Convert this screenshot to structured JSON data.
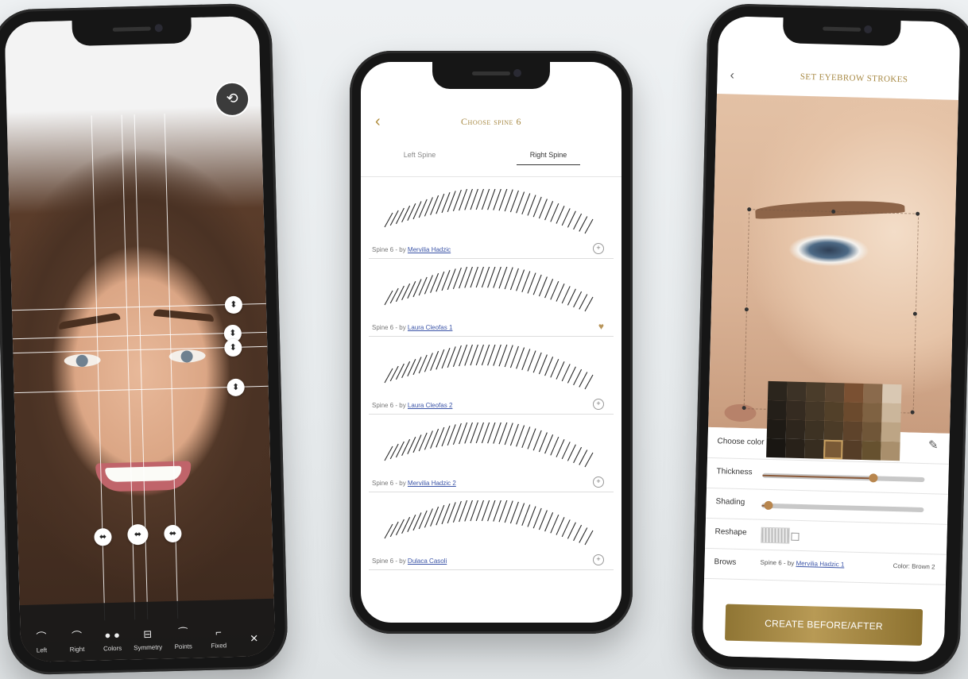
{
  "left_screen": {
    "toolbar": [
      {
        "label": "Left",
        "icon": "brow-left-icon"
      },
      {
        "label": "Right",
        "icon": "brow-right-icon"
      },
      {
        "label": "Colors",
        "icon": "color-dots-icon"
      },
      {
        "label": "Symmetry",
        "icon": "symmetry-icon"
      },
      {
        "label": "Points",
        "icon": "points-icon"
      },
      {
        "label": "Fixed",
        "icon": "fixed-icon"
      },
      {
        "label": "",
        "icon": "close-icon"
      }
    ]
  },
  "center_screen": {
    "title": "Choose spine 6",
    "tabs": [
      {
        "label": "Left Spine",
        "active": false
      },
      {
        "label": "Right Spine",
        "active": true
      }
    ],
    "brows": [
      {
        "prefix": "Spine 6 - by ",
        "author": "Mervilia Hadzic",
        "favorite": false
      },
      {
        "prefix": "Spine 6 - by ",
        "author": "Laura Cleofas 1",
        "favorite": true
      },
      {
        "prefix": "Spine 6 - by ",
        "author": "Laura Cleofas 2",
        "favorite": false
      },
      {
        "prefix": "Spine 6 - by ",
        "author": "Mervilia Hadzic 2",
        "favorite": false
      },
      {
        "prefix": "Spine 6 - by ",
        "author": "Dulaca Casoli",
        "favorite": false
      }
    ]
  },
  "right_screen": {
    "title": "SET EYEBROW STROKES",
    "choose_color_label": "Choose color",
    "thickness_label": "Thickness",
    "thickness_value": 0.68,
    "shading_label": "Shading",
    "shading_value": 0.04,
    "reshape_label": "Reshape",
    "brows_label": "Brows",
    "brows_prefix": "Spine 6 - by ",
    "brows_author": "Mervilia Hadzic 1",
    "brows_color": "Color: Brown 2",
    "cta": "CREATE BEFORE/AFTER",
    "palette": [
      "#2b251d",
      "#3c3226",
      "#4a3c2a",
      "#5a4530",
      "#7a5032",
      "#8a6a4c",
      "#d9c8b3",
      "#241f19",
      "#352b21",
      "#443727",
      "#524029",
      "#6b4a2d",
      "#7f6242",
      "#cbb69b",
      "#1e1a15",
      "#2e261d",
      "#3d3223",
      "#4b3b27",
      "#5e432b",
      "#705638",
      "#bda585",
      "#191612",
      "#282119",
      "#372d20",
      "#7a5a36",
      "#553d27",
      "#66512f",
      "#a98f6c"
    ],
    "selected_swatch": 24
  }
}
